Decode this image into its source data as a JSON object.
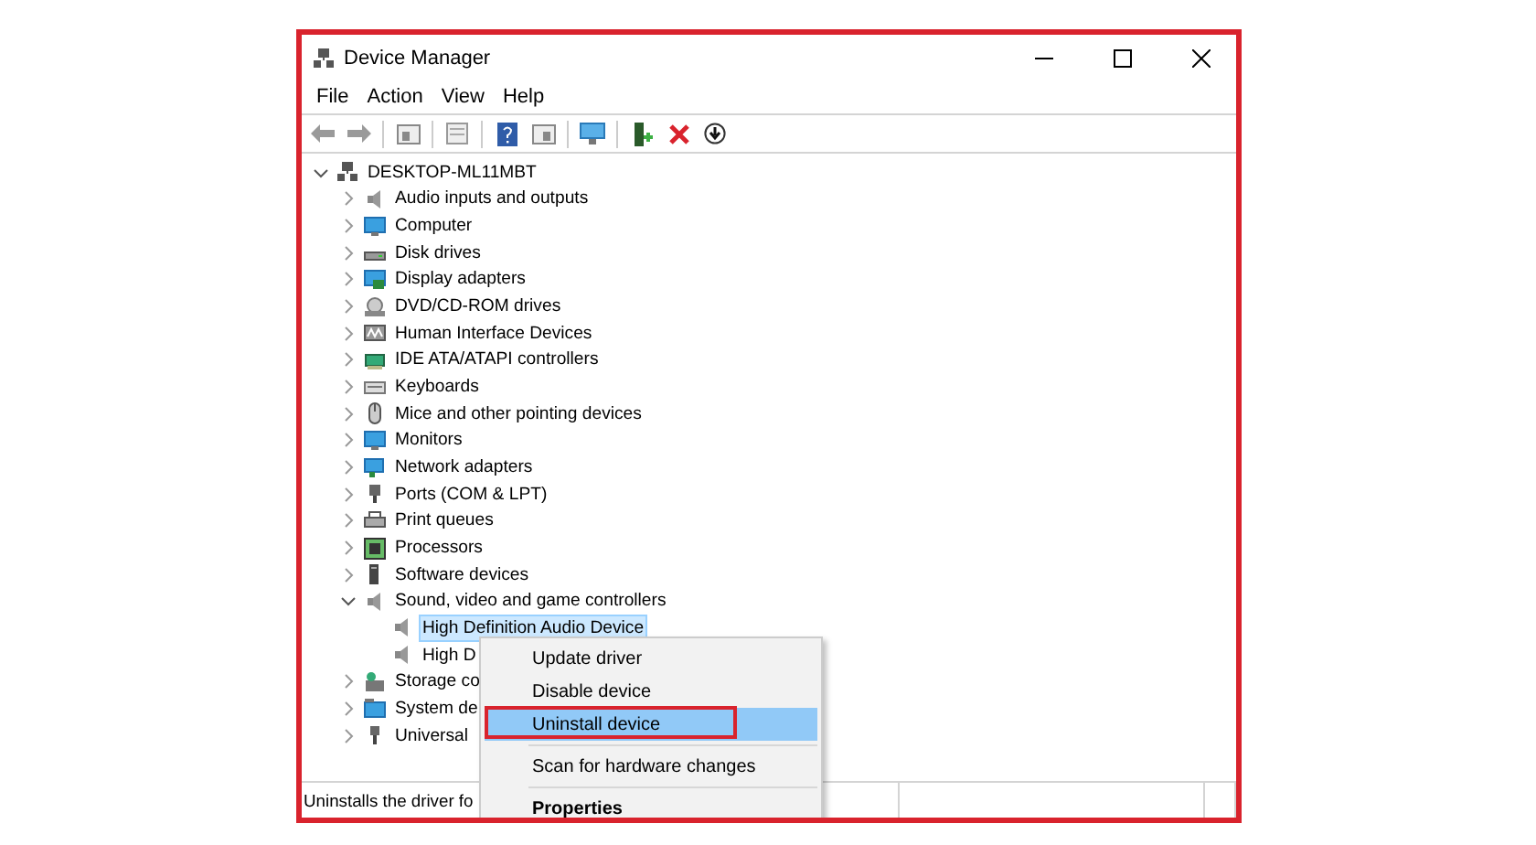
{
  "window": {
    "title": "Device Manager"
  },
  "menu_bar": [
    "File",
    "Action",
    "View",
    "Help"
  ],
  "tree": {
    "root": {
      "label": "DESKTOP-ML11MBT",
      "expanded": true,
      "selected": false,
      "children": [
        {
          "label": "Audio inputs and outputs",
          "expanded": false,
          "selected": false
        },
        {
          "label": "Computer",
          "expanded": false,
          "selected": false
        },
        {
          "label": "Disk drives",
          "expanded": false,
          "selected": false
        },
        {
          "label": "Display adapters",
          "expanded": false,
          "selected": false
        },
        {
          "label": "DVD/CD-ROM drives",
          "expanded": false,
          "selected": false
        },
        {
          "label": "Human Interface Devices",
          "expanded": false,
          "selected": false
        },
        {
          "label": "IDE ATA/ATAPI controllers",
          "expanded": false,
          "selected": false
        },
        {
          "label": "Keyboards",
          "expanded": false,
          "selected": false
        },
        {
          "label": "Mice and other pointing devices",
          "expanded": false,
          "selected": false
        },
        {
          "label": "Monitors",
          "expanded": false,
          "selected": false
        },
        {
          "label": "Network adapters",
          "expanded": false,
          "selected": false
        },
        {
          "label": "Ports (COM & LPT)",
          "expanded": false,
          "selected": false
        },
        {
          "label": "Print queues",
          "expanded": false,
          "selected": false
        },
        {
          "label": "Processors",
          "expanded": false,
          "selected": false
        },
        {
          "label": "Software devices",
          "expanded": false,
          "selected": false
        },
        {
          "label": "Sound, video and game controllers",
          "expanded": true,
          "selected": false,
          "children": [
            {
              "label": "High Definition Audio Device",
              "selected": true
            },
            {
              "label": "High D",
              "selected": false
            }
          ]
        },
        {
          "label": "Storage co",
          "expanded": false,
          "selected": false
        },
        {
          "label": "System de",
          "expanded": false,
          "selected": false
        },
        {
          "label": "Universal",
          "expanded": false,
          "selected": false
        }
      ]
    }
  },
  "context_menu": [
    {
      "kind": "item",
      "label": "Update driver",
      "selected": false,
      "annotated": false,
      "default": false
    },
    {
      "kind": "item",
      "label": "Disable device",
      "selected": false,
      "annotated": false,
      "default": false
    },
    {
      "kind": "item",
      "label": "Uninstall device",
      "selected": true,
      "annotated": true,
      "default": false
    },
    {
      "kind": "separator"
    },
    {
      "kind": "item",
      "label": "Scan for hardware changes",
      "selected": false,
      "annotated": false,
      "default": false
    },
    {
      "kind": "separator"
    },
    {
      "kind": "item",
      "label": "Properties",
      "selected": false,
      "annotated": false,
      "default": true
    }
  ],
  "status_bar": {
    "text": "Uninstalls the driver fo"
  }
}
